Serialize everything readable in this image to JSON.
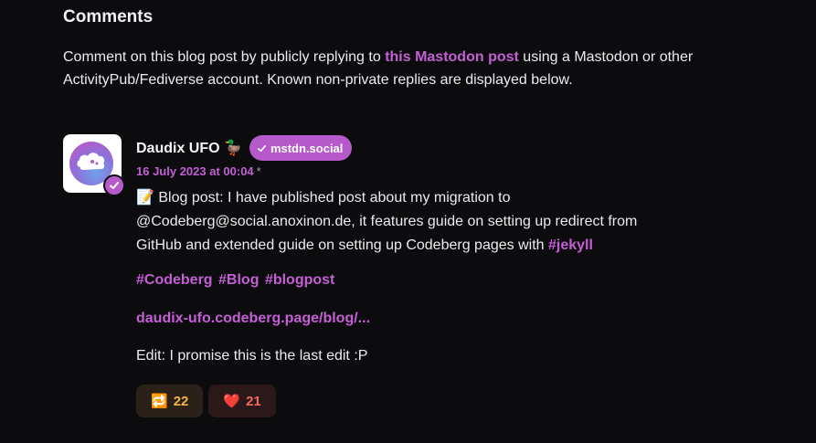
{
  "section": {
    "title": "Comments",
    "intro_before": "Comment on this blog post by publicly replying to ",
    "intro_link": "this Mastodon post",
    "intro_after": " using a Mastodon or other ActivityPub/Fediverse account. Known non-private replies are displayed below."
  },
  "comment": {
    "author_name": "Daudix UFO 🦆",
    "instance": "mstdn.social",
    "date": "16 July 2023 at 00:04",
    "edited_marker": "*",
    "body_line1": "📝 Blog post: I have published post about my migration to",
    "body_line2": "@Codeberg@social.anoxinon.de, it features guide on setting up redirect from",
    "body_line3_prefix": "GitHub and extended guide on setting up Codeberg pages with ",
    "body_line3_tag": "#jekyll",
    "tags": [
      "#Codeberg",
      "#Blog",
      "#blogpost"
    ],
    "url_text": "daudix-ufo.codeberg.page/blog/...",
    "edit_note": "Edit: I promise this is the last edit :P",
    "boost_icon": "🔁",
    "boost_count": "22",
    "fav_icon": "❤️",
    "fav_count": "21"
  },
  "colors": {
    "accent": "#c45fd6",
    "badge": "#b65acb",
    "background": "#0c0b0d",
    "boost": "#f2b54f",
    "favorite": "#f06a5f"
  }
}
